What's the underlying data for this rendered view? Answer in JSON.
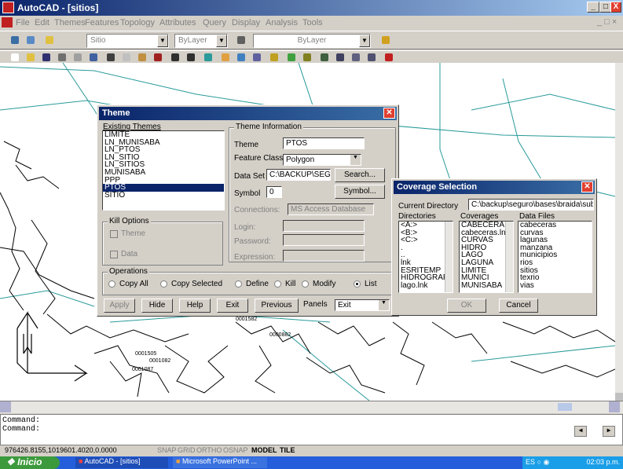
{
  "window": {
    "title": "AutoCAD - [sitios]",
    "controls": [
      "_",
      "□",
      "X"
    ]
  },
  "menu": [
    "File",
    "Edit",
    "Themes",
    "Features",
    "Topology",
    "Attributes",
    "Query",
    "Display",
    "Analysis",
    "Tools"
  ],
  "props_toolbar": {
    "layer": "Sitio",
    "color": "ByLayer",
    "linetype": "ByLayer"
  },
  "map_labels": [
    "0001505",
    "0001082",
    "0001087",
    "0000882",
    "0001582"
  ],
  "theme_dialog": {
    "title": "Theme",
    "existing_label": "Existing Themes",
    "themes": [
      "LIMITE",
      "LN_MUNISABA",
      "LN_PTOS",
      "LN_SITIO",
      "LN_SITIOS",
      "MUNISABA",
      "PPP",
      "PTOS",
      "SITIO"
    ],
    "selected_theme": "PTOS",
    "info_label": "Theme Information",
    "theme_label": "Theme",
    "theme_value": "PTOS",
    "feature_label": "Feature Class",
    "feature_value": "Polygon",
    "dataset_label": "Data Set",
    "dataset_value": "C:\\BACKUP\\SEG",
    "search_btn": "Search...",
    "symbol_label": "Symbol",
    "symbol_value": "0",
    "symbol_btn": "Symbol...",
    "connections_label": "Connections:",
    "connections_value": "MS Access Database",
    "login_label": "Login:",
    "password_label": "Password:",
    "expression_label": "Expression:",
    "kill_label": "Kill Options",
    "kill_theme": "Theme",
    "kill_data": "Data",
    "ops_label": "Operations",
    "ops": [
      "Copy All",
      "Copy Selected",
      "Define",
      "Kill",
      "Modify",
      "List"
    ],
    "ops_selected": "List",
    "buttons": [
      "Apply",
      "Hide",
      "Help",
      "Exit",
      "Previous"
    ],
    "panels_label": "Panels",
    "panels_value": "Exit"
  },
  "coverage_dialog": {
    "title": "Coverage Selection",
    "current_dir_label": "Current Directory",
    "current_dir": "C:\\backup\\seguro\\bases\\braida\\subirar",
    "directories_label": "Directories",
    "directories": [
      "<A:>",
      "<B:>",
      "<C:>",
      ".",
      "..",
      "lnk",
      "ESRITEMP",
      "HIDROGRAFI…",
      "lago.lnk"
    ],
    "coverages_label": "Coverages",
    "coverages": [
      "CABECERA",
      "cabeceras.lnk",
      "CURVAS",
      "HIDRO",
      "LAGO",
      "LAGUNA",
      "LIMITE",
      "MUNICI",
      "MUNISABA"
    ],
    "datafiles_label": "Data Files",
    "datafiles": [
      "cabeceras",
      "curvas",
      "lagunas",
      "manzana",
      "municipios",
      "rios",
      "sitios",
      "texrio",
      "vias"
    ],
    "ok": "OK",
    "cancel": "Cancel"
  },
  "command_lines": [
    "Command:",
    "Command:"
  ],
  "status": {
    "coords": "976426.8155,1019601.4020,0.0000",
    "toggles": [
      "SNAP",
      "GRID",
      "ORTHO",
      "OSNAP"
    ],
    "active": [
      "MODEL",
      "TILE"
    ]
  },
  "taskbar": {
    "start": "Inicio",
    "tasks": [
      "AutoCAD - [sitios]",
      "Microsoft PowerPoint ..."
    ],
    "lang": "ES",
    "time": "02:03 p.m."
  },
  "colors": {
    "title": "#0a246a",
    "taskbar": "#245edb",
    "start": "#3c9a3c",
    "map_lines": "#2a9a9a"
  }
}
